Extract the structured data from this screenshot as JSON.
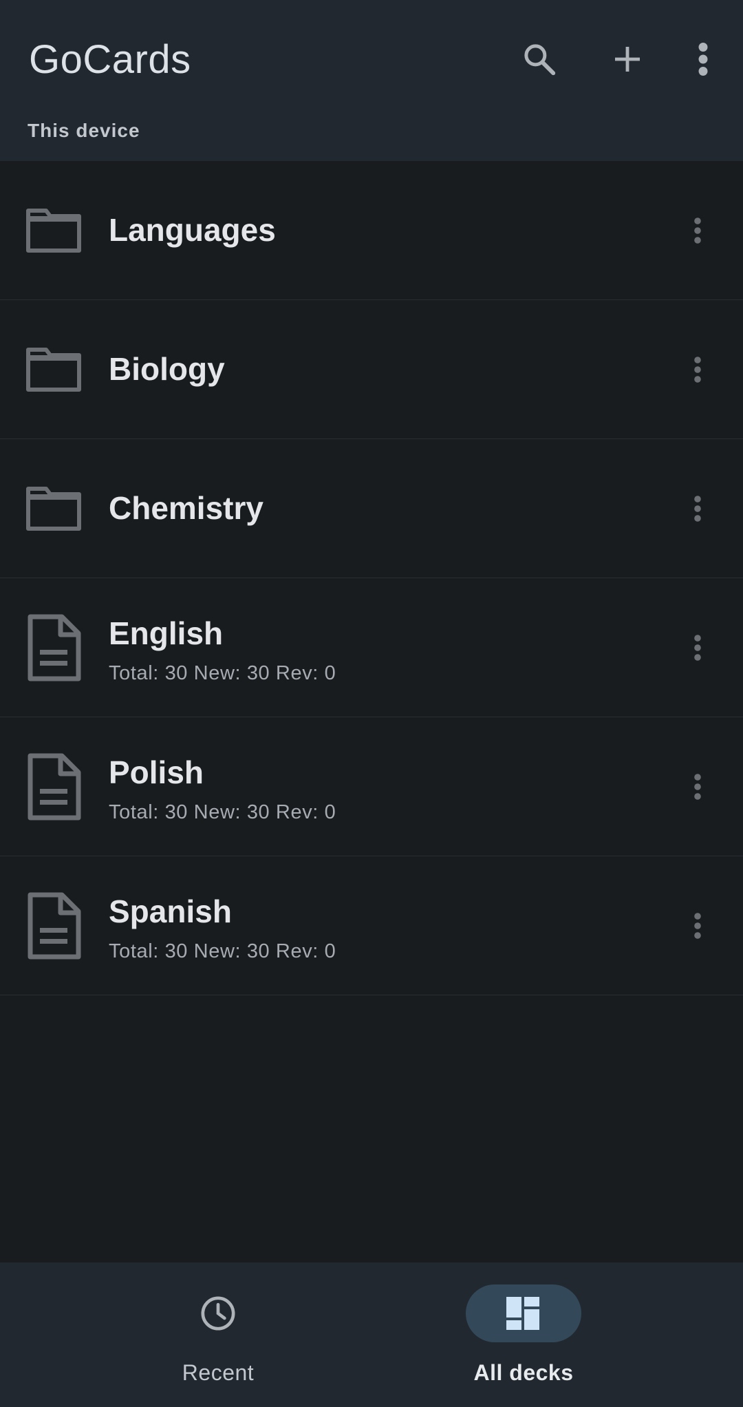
{
  "app_bar": {
    "title": "GoCards",
    "subtitle": "This device",
    "actions": [
      {
        "icon": "search-icon"
      },
      {
        "icon": "plus-icon"
      },
      {
        "icon": "more-vertical-icon"
      }
    ]
  },
  "items": [
    {
      "type": "folder",
      "icon": "folder-icon",
      "title": "Languages"
    },
    {
      "type": "folder",
      "icon": "folder-icon",
      "title": "Biology"
    },
    {
      "type": "folder",
      "icon": "folder-icon",
      "title": "Chemistry"
    },
    {
      "type": "deck",
      "icon": "document-icon",
      "title": "English",
      "stats": "Total: 30 New: 30 Rev: 0"
    },
    {
      "type": "deck",
      "icon": "document-icon",
      "title": "Polish",
      "stats": "Total: 30 New: 30 Rev: 0"
    },
    {
      "type": "deck",
      "icon": "document-icon",
      "title": "Spanish",
      "stats": "Total: 30 New: 30 Rev: 0"
    }
  ],
  "bottom_nav": {
    "items": [
      {
        "label": "Recent",
        "icon": "clock-icon",
        "active": false
      },
      {
        "label": "All decks",
        "icon": "dashboard-icon",
        "active": true
      }
    ]
  },
  "colors": {
    "background": "#191c1f",
    "app_bar": "#22282f",
    "active_pill": "#33495a",
    "icon": "#6c7074"
  }
}
